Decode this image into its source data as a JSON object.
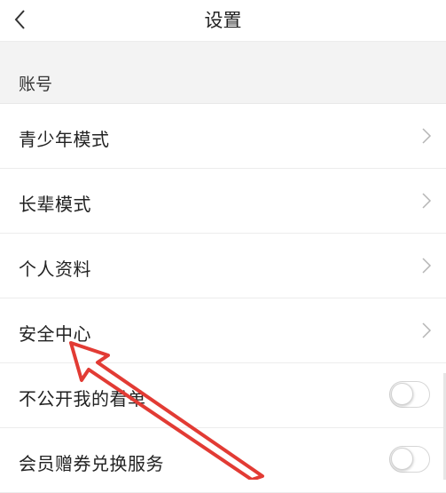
{
  "header": {
    "title": "设置",
    "back_icon": "chevron-left-icon"
  },
  "section": {
    "title": "账号"
  },
  "rows": [
    {
      "label": "青少年模式",
      "control": "chevron-right-icon"
    },
    {
      "label": "长辈模式",
      "control": "chevron-right-icon"
    },
    {
      "label": "个人资料",
      "control": "chevron-right-icon"
    },
    {
      "label": "安全中心",
      "control": "chevron-right-icon"
    },
    {
      "label": "不公开我的看单",
      "control": "toggle",
      "toggle_on": false
    },
    {
      "label": "会员赠券兑换服务",
      "control": "toggle",
      "toggle_on": false
    }
  ],
  "annotation": {
    "arrow_color": "#e23b34",
    "points_to": "安全中心"
  }
}
